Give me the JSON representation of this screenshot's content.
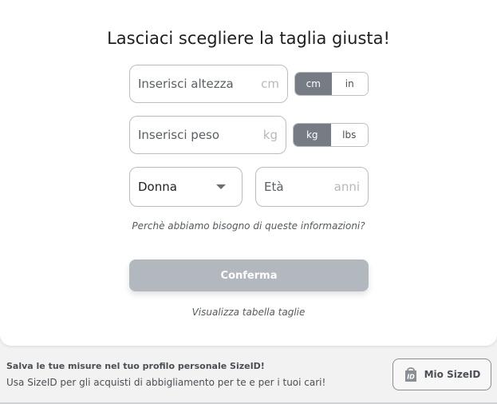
{
  "title": "Lasciaci scegliere la taglia giusta!",
  "height": {
    "placeholder": "Inserisci altezza",
    "unit": "cm"
  },
  "height_units": {
    "options": [
      "cm",
      "in"
    ],
    "selected": "cm"
  },
  "weight": {
    "placeholder": "Inserisci peso",
    "unit": "kg"
  },
  "weight_units": {
    "options": [
      "kg",
      "lbs"
    ],
    "selected": "kg"
  },
  "gender": {
    "value": "Donna"
  },
  "age": {
    "placeholder": "Età",
    "unit": "anni"
  },
  "why_link": "Perchè abbiamo bisogno di queste informazioni?",
  "confirm_label": "Conferma",
  "size_chart_link": "Visualizza tabella taglie",
  "footer": {
    "title": "Salva le tue misure nel tuo profilo personale SizeID!",
    "subtitle": "Usa SizeID per gli acquisti di abbigliamento per te e per i tuoi cari!",
    "button_label": "Mio SizeID",
    "button_icon": "sizeid-bag-icon"
  },
  "colors": {
    "active_toggle": "#767c84",
    "confirm_disabled": "#b3b8be",
    "border": "#b9bdc3"
  }
}
